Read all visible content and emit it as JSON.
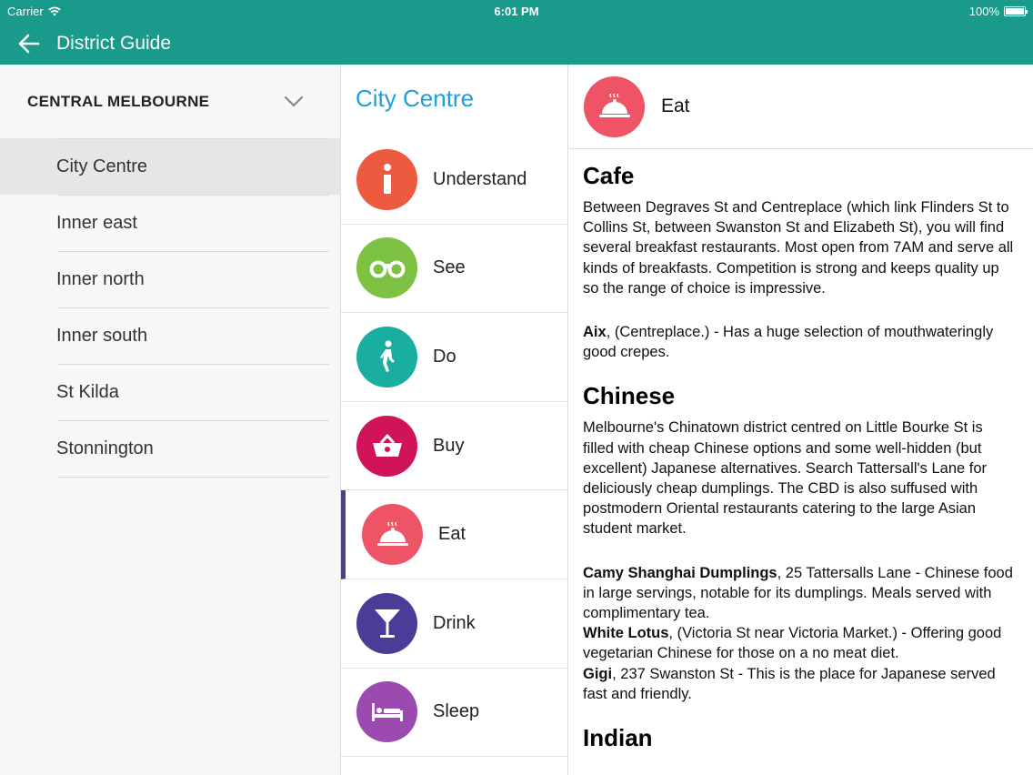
{
  "status": {
    "carrier": "Carrier",
    "time": "6:01 PM",
    "battery": "100%"
  },
  "nav": {
    "title": "District Guide"
  },
  "region": {
    "label": "CENTRAL MELBOURNE"
  },
  "districts": [
    {
      "label": "City Centre"
    },
    {
      "label": "Inner east"
    },
    {
      "label": "Inner north"
    },
    {
      "label": "Inner south"
    },
    {
      "label": "St Kilda"
    },
    {
      "label": "Stonnington"
    }
  ],
  "middle": {
    "title": "City Centre"
  },
  "categories": [
    {
      "label": "Understand",
      "color": "#ec5b3f",
      "icon": "info-icon"
    },
    {
      "label": "See",
      "color": "#7dc242",
      "icon": "binoculars-icon"
    },
    {
      "label": "Do",
      "color": "#1aaea0",
      "icon": "walking-person-icon"
    },
    {
      "label": "Buy",
      "color": "#d1135a",
      "icon": "shopping-basket-icon"
    },
    {
      "label": "Eat",
      "color": "#ee5366",
      "icon": "food-cloche-icon"
    },
    {
      "label": "Drink",
      "color": "#4a3d98",
      "icon": "cocktail-glass-icon"
    },
    {
      "label": "Sleep",
      "color": "#9b4bb0",
      "icon": "bed-icon"
    }
  ],
  "detail": {
    "title": "Eat",
    "sections": {
      "cafe": {
        "heading": "Cafe",
        "intro": "Between Degraves St and Centreplace (which link Flinders St to Collins St, between Swanston St and Elizabeth St), you will find several breakfast restaurants. Most open from 7AM and serve all kinds of breakfasts. Competition is strong and keeps quality up so the range of choice is impressive.",
        "listing1_name": "Aix",
        "listing1_text": ", (Centreplace.) - Has a huge selection of mouthwateringly good crepes."
      },
      "chinese": {
        "heading": "Chinese",
        "intro": "Melbourne's Chinatown district centred on Little Bourke St is filled with cheap Chinese options and some well-hidden (but excellent) Japanese alternatives. Search Tattersall's Lane for deliciously cheap dumplings. The CBD is also suffused with postmodern Oriental restaurants catering to the large Asian student market.",
        "listing1_name": "Camy Shanghai Dumplings",
        "listing1_text": ", 25 Tattersalls Lane - Chinese food in large servings, notable for its dumplings. Meals served with complimentary tea.",
        "listing2_name": "White Lotus",
        "listing2_text": ", (Victoria St near Victoria Market.) - Offering good vegetarian Chinese for those on a no meat diet.",
        "listing3_name": "Gigi",
        "listing3_text": ", 237 Swanston St - This is the place for Japanese served fast and friendly."
      },
      "indian": {
        "heading": "Indian"
      }
    }
  }
}
